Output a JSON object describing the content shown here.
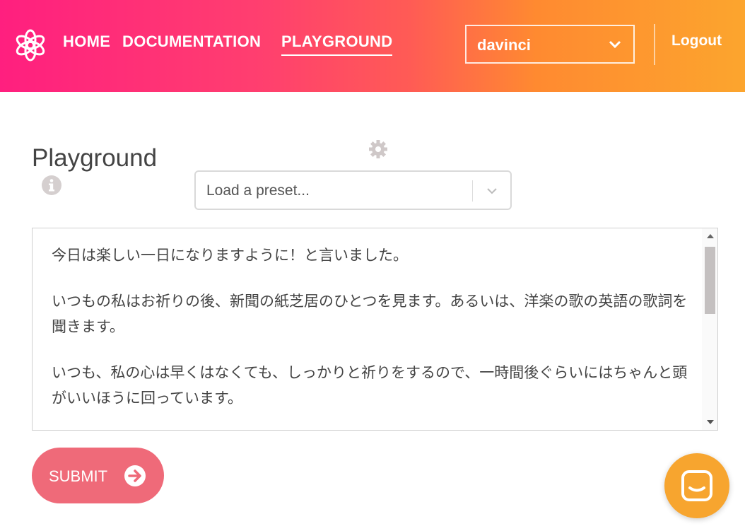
{
  "header": {
    "nav": {
      "home": "HOME",
      "documentation": "DOCUMENTATION",
      "playground": "PLAYGROUND"
    },
    "model_select": {
      "value": "davinci"
    },
    "logout": "Logout",
    "gradient": [
      "#ff1f7f",
      "#ff5b55",
      "#fca52e"
    ]
  },
  "main": {
    "title": "Playground",
    "preset": {
      "placeholder": "Load a preset..."
    },
    "prompt": {
      "paragraphs": [
        "今日は楽しい一日になりますように！と言いました。",
        "いつもの私はお祈りの後、新聞の紙芝居のひとつを見ます。あるいは、洋楽の歌の英語の歌詞を聞きます。",
        "いつも、私の心は早くはなくても、しっかりと祈りをするので、一時間後ぐらいにはちゃんと頭がいいほうに回っています。"
      ]
    },
    "submit_label": "SUBMIT"
  },
  "colors": {
    "submit": "#ef6a79",
    "chat_bubble": "#f7a52f"
  },
  "icons": {
    "logo": "openai-logo-icon",
    "info": "info-icon",
    "settings": "gear-icon",
    "chevron": "chevron-down-icon",
    "submit_arrow": "arrow-right-circle-icon",
    "chat": "chat-icon"
  }
}
